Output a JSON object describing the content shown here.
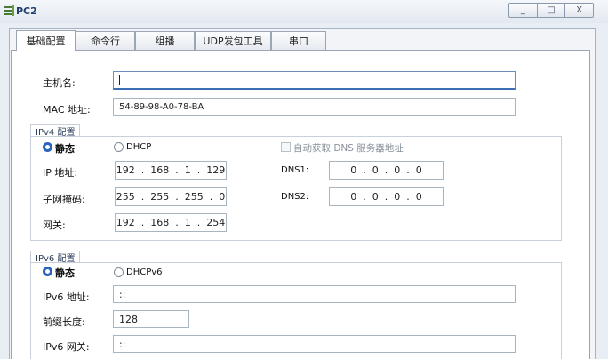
{
  "window": {
    "title": "PC2",
    "controls": [
      "_",
      "□",
      "X"
    ]
  },
  "tabs": [
    {
      "label": "基础配置",
      "active": true
    },
    {
      "label": "命令行"
    },
    {
      "label": "组播"
    },
    {
      "label": "UDP发包工具"
    },
    {
      "label": "串口"
    }
  ],
  "basic": {
    "hostname_label": "主机名:",
    "hostname_value": "",
    "mac_label": "MAC 地址:",
    "mac_value": "54-89-98-A0-78-BA"
  },
  "ipv4": {
    "group_title": "IPv4 配置",
    "static_label": "静态",
    "dhcp_label": "DHCP",
    "auto_dns_label": "自动获取 DNS 服务器地址",
    "ip_label": "IP 地址:",
    "ip_value": "192  .  168  .  1  .  129",
    "mask_label": "子网掩码:",
    "mask_value": "255  .  255  .  255  .  0",
    "gateway_label": "网关:",
    "gateway_value": "192  .  168  .  1  .  254",
    "dns1_label": "DNS1:",
    "dns1_value": "0  .  0  .  0  .  0",
    "dns2_label": "DNS2:",
    "dns2_value": "0  .  0  .  0  .  0"
  },
  "ipv6": {
    "group_title": "IPv6 配置",
    "static_label": "静态",
    "dhcp_label": "DHCPv6",
    "ip_label": "IPv6 地址:",
    "ip_value": "::",
    "prefix_label": "前缀长度:",
    "prefix_value": "128",
    "gateway_label": "IPv6 网关:",
    "gateway_value": "::"
  },
  "colors": {
    "accent": "#2a63c1",
    "title_text": "#1f3f6e"
  }
}
